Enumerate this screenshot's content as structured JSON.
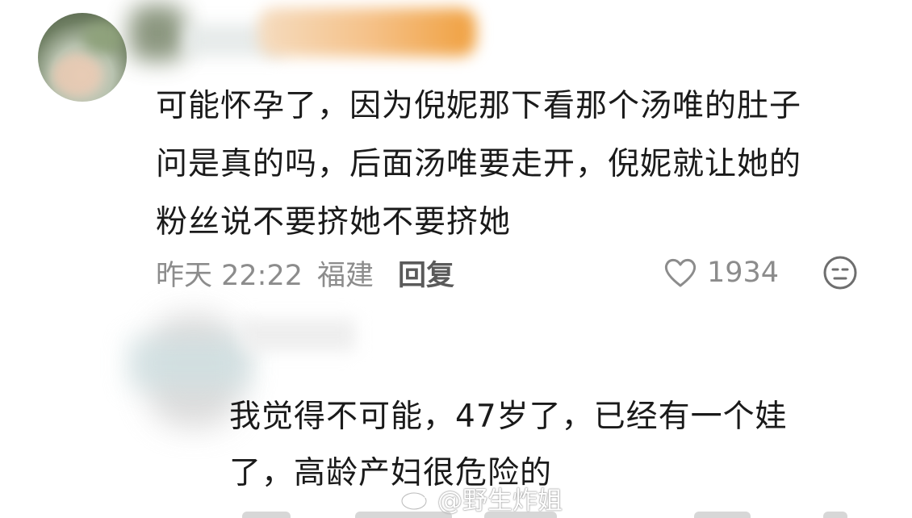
{
  "comment": {
    "lines": [
      "可能怀孕了，因为倪妮那下看那个汤唯的肚子",
      "问是真的吗，后面汤唯要走开，倪妮就让她的",
      "粉丝说不要挤她不要挤她"
    ],
    "time": "昨天 22:22",
    "location": "福建",
    "reply_label": "回复",
    "like_count": "1934",
    "like_icon": "heart-icon",
    "extra_icon": "emoji-face-icon"
  },
  "reply_comment": {
    "lines": [
      "我觉得不可能，47岁了，已经有一个娃",
      "了，高龄产妇很危险的"
    ]
  },
  "watermark": {
    "text": "@野生炸姐",
    "icon": "weibo-logo-icon"
  },
  "colors": {
    "text": "#1a1a1a",
    "meta": "#8c8c8c",
    "reply": "#5a5a5a"
  }
}
